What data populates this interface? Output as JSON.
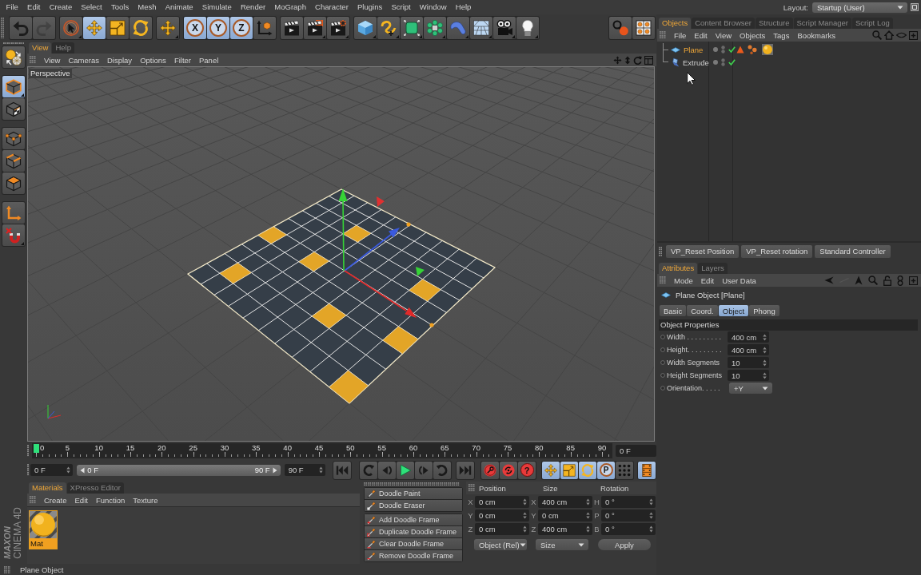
{
  "menu_bar": {
    "items": [
      "File",
      "Edit",
      "Create",
      "Select",
      "Tools",
      "Mesh",
      "Animate",
      "Simulate",
      "Render",
      "MoGraph",
      "Character",
      "Plugins",
      "Script",
      "Window",
      "Help"
    ],
    "layout_label": "Layout:",
    "layout_value": "Startup (User)"
  },
  "toolbar": {
    "buttons": [
      {
        "selected": false,
        "disabled": false
      },
      {
        "selected": false,
        "disabled": true
      },
      {
        "selected": false,
        "disabled": false
      },
      {
        "selected": true,
        "disabled": false
      },
      {
        "selected": false,
        "disabled": false
      },
      {
        "selected": false,
        "disabled": false
      },
      {
        "selected": false,
        "disabled": false
      },
      {
        "label": "X",
        "selected": true,
        "disabled": false
      },
      {
        "label": "Y",
        "selected": true,
        "disabled": false
      },
      {
        "label": "Z",
        "selected": true,
        "disabled": false
      },
      {
        "selected": false,
        "disabled": false
      },
      {
        "selected": false,
        "disabled": false
      },
      {
        "selected": false,
        "disabled": false
      },
      {
        "selected": false,
        "disabled": false
      },
      {
        "selected": false,
        "disabled": false
      },
      {
        "selected": false,
        "disabled": false
      },
      {
        "selected": false,
        "disabled": false
      },
      {
        "selected": false,
        "disabled": false
      },
      {
        "selected": false,
        "disabled": false
      },
      {
        "selected": false,
        "disabled": false
      },
      {
        "selected": false,
        "disabled": false
      },
      {
        "selected": false,
        "disabled": false
      },
      {
        "selected": false,
        "disabled": false
      },
      {
        "selected": false,
        "disabled": false
      }
    ]
  },
  "objects_panel": {
    "tabs": [
      {
        "label": "Objects",
        "selected": true
      },
      {
        "label": "Content Browser",
        "selected": false
      },
      {
        "label": "Structure",
        "selected": false
      },
      {
        "label": "Script Manager",
        "selected": false
      },
      {
        "label": "Script Log",
        "selected": false
      }
    ],
    "menu": [
      "File",
      "Edit",
      "View",
      "Objects",
      "Tags",
      "Bookmarks"
    ],
    "objects": [
      {
        "name": "Plane",
        "kind": "plane",
        "selected": true,
        "enabled": true,
        "tags": [
          {
            "kind": "triangle"
          },
          {
            "kind": "dots"
          },
          {
            "kind": "material"
          }
        ]
      },
      {
        "name": "Extrude",
        "kind": "extrude",
        "selected": false,
        "enabled": true
      }
    ]
  },
  "mode_bar": {
    "buttons": [
      {
        "selected": false
      },
      {
        "selected": true
      },
      {
        "selected": false
      },
      {
        "selected": false
      },
      {
        "selected": false
      },
      {
        "selected": false
      },
      {
        "selected": false
      },
      {
        "selected": false
      }
    ]
  },
  "viewport": {
    "tabs": [
      {
        "label": "View",
        "selected": true
      },
      {
        "label": "Help",
        "selected": false
      }
    ],
    "menu": [
      "View",
      "Cameras",
      "Display",
      "Options",
      "Filter",
      "Panel"
    ],
    "camera": "Perspective"
  },
  "user_buttons": [
    "VP_Reset Position",
    "VP_Reset rotation",
    "Standard Controller"
  ],
  "attributes": {
    "tabs": [
      {
        "label": "Attributes",
        "selected": true
      },
      {
        "label": "Layers",
        "selected": false
      }
    ],
    "menu": [
      "Mode",
      "Edit",
      "User Data"
    ],
    "title": "Plane Object [Plane]",
    "sections": [
      {
        "label": "Basic",
        "selected": false
      },
      {
        "label": "Coord.",
        "selected": false
      },
      {
        "label": "Object",
        "selected": true
      },
      {
        "label": "Phong",
        "selected": false
      }
    ],
    "group_title": "Object Properties",
    "fields": [
      {
        "label": "Width . . . . . . . . .",
        "value": "400 cm",
        "kind": "spin"
      },
      {
        "label": "Height. . . . . . . . .",
        "value": "400 cm",
        "kind": "spin"
      },
      {
        "label": "Width Segments",
        "value": "10",
        "kind": "spin"
      },
      {
        "label": "Height Segments",
        "value": "10",
        "kind": "spin"
      },
      {
        "label": "Orientation. . . . .",
        "value": "+Y",
        "kind": "dropdown"
      }
    ]
  },
  "timeline": {
    "ticks": [
      "0",
      "5",
      "10",
      "15",
      "20",
      "25",
      "30",
      "35",
      "40",
      "45",
      "50",
      "55",
      "60",
      "65",
      "70",
      "75",
      "80",
      "85",
      "90"
    ],
    "level": 0,
    "current_frame": "0 F"
  },
  "frame_controls": {
    "start": "0 F",
    "range": {
      "start": "0 F",
      "end": "90 F",
      "level": 1
    },
    "end": "90 F",
    "buttons": [
      {
        "selected": false
      },
      {
        "selected": false
      },
      {
        "selected": false
      },
      {
        "selected": false
      },
      {
        "selected": false
      },
      {
        "selected": false
      },
      {
        "selected": false
      },
      {
        "selected": false
      },
      {
        "selected": false
      },
      {
        "label": "?",
        "selected": false
      },
      {
        "selected": true
      },
      {
        "selected": true
      },
      {
        "selected": true
      },
      {
        "label": "P",
        "selected": true
      },
      {
        "selected": false
      },
      {
        "selected": true
      }
    ]
  },
  "materials": {
    "tabs": [
      {
        "label": "Materials",
        "selected": true
      },
      {
        "label": "XPresso Editor",
        "selected": false
      }
    ],
    "menu": [
      "Create",
      "Edit",
      "Function",
      "Texture"
    ],
    "items": [
      {
        "name": "Mat",
        "selected": true
      }
    ]
  },
  "logo": {
    "brand": "MAXON",
    "product": "CINEMA 4D"
  },
  "doodle": {
    "groups": [
      {
        "items": [
          "Doodle Paint",
          "Doodle Eraser"
        ]
      },
      {
        "items": [
          "Add Doodle Frame",
          "Duplicate Doodle Frame",
          "Clear Doodle Frame",
          "Remove Doodle Frame"
        ]
      }
    ]
  },
  "coordinates": {
    "columns": [
      "Position",
      "Size",
      "Rotation"
    ],
    "rows": [
      [
        {
          "axis": "X",
          "value": "0 cm"
        },
        {
          "axis": "X",
          "value": "400 cm"
        },
        {
          "axis": "H",
          "value": "0 °"
        }
      ],
      [
        {
          "axis": "Y",
          "value": "0 cm"
        },
        {
          "axis": "Y",
          "value": "0 cm"
        },
        {
          "axis": "P",
          "value": "0 °"
        }
      ],
      [
        {
          "axis": "Z",
          "value": "0 cm"
        },
        {
          "axis": "Z",
          "value": "400 cm"
        },
        {
          "axis": "B",
          "value": "0 °"
        }
      ]
    ],
    "mode": "Object (Rel)",
    "size_mode": "Size",
    "apply": "Apply"
  },
  "status_bar": {
    "text": "Plane Object"
  }
}
